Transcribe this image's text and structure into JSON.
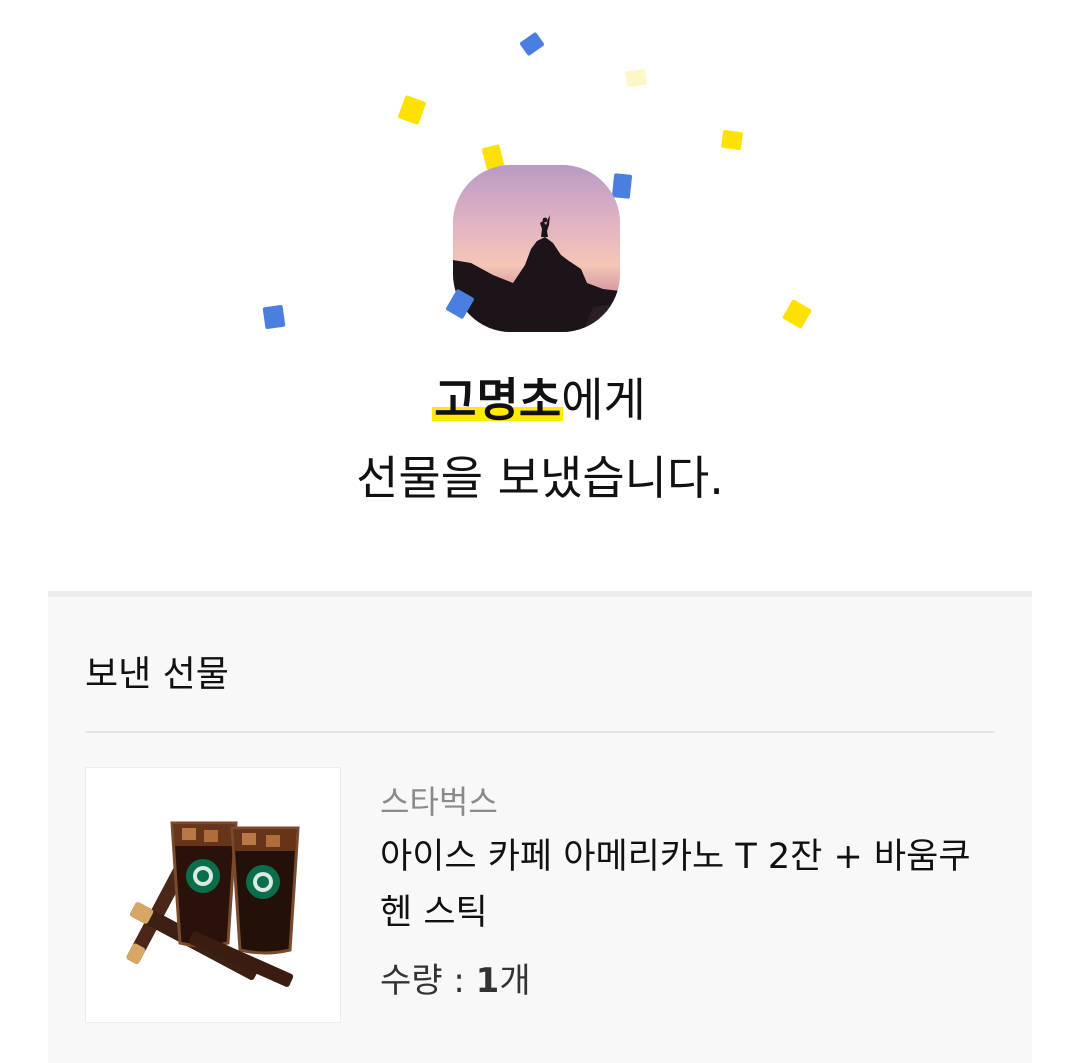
{
  "colors": {
    "highlight": "#ffeb00",
    "confetti_yellow": "#ffe100",
    "confetti_blue": "#4a7fe0",
    "confetti_pale": "#fff6c8"
  },
  "confetti": [
    {
      "color": "#4a7fe0"
    },
    {
      "color": "#fff6c8"
    },
    {
      "color": "#ffe100"
    },
    {
      "color": "#ffe100"
    },
    {
      "color": "#ffe100"
    },
    {
      "color": "#4a7fe0"
    },
    {
      "color": "#4a7fe0"
    },
    {
      "color": "#4a7fe0"
    },
    {
      "color": "#ffe100"
    }
  ],
  "header": {
    "recipient_name": "고명초",
    "recipient_suffix": "에게",
    "message": "선물을 보냈습니다."
  },
  "sent_gift": {
    "section_title": "보낸 선물",
    "brand": "스타벅스",
    "product_name": "아이스 카페 아메리카노 T 2잔 + 바움쿠헨 스틱",
    "quantity_label": "수량 : ",
    "quantity_value": "1",
    "quantity_unit": "개"
  }
}
